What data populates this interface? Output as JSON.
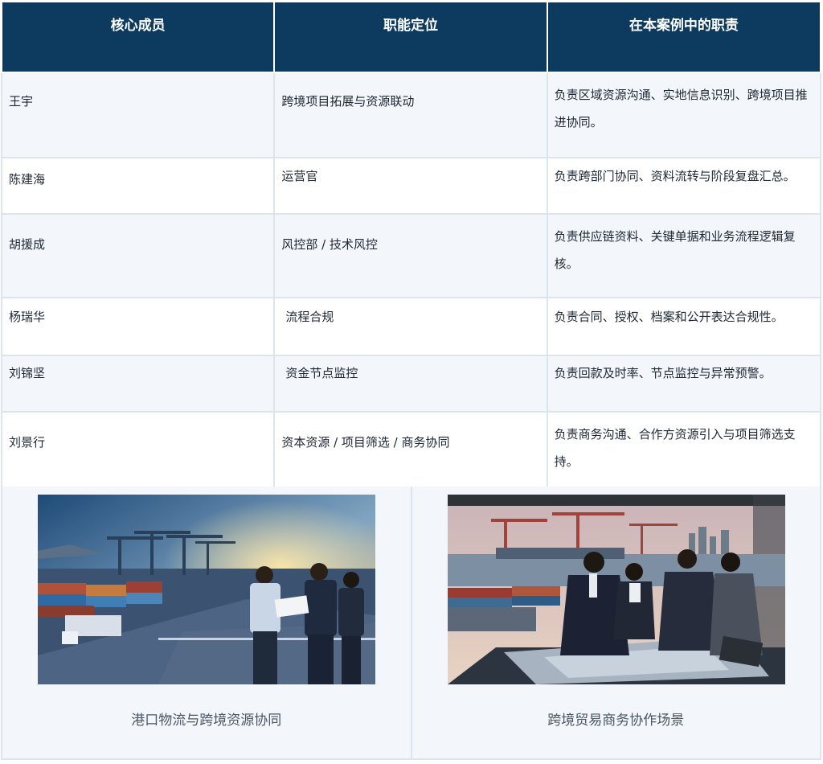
{
  "table": {
    "headers": [
      "核心成员",
      "职能定位",
      "在本案例中的职责"
    ],
    "rows": [
      {
        "name": "王宇",
        "role": "跨境项目拓展与资源联动",
        "duty": "负责区域资源沟通、实地信息识别、跨境项目推进协同。"
      },
      {
        "name": "陈建海",
        "role": "运营官",
        "duty": "负责跨部门协同、资料流转与阶段复盘汇总。"
      },
      {
        "name": "胡援成",
        "role": "风控部 / 技术风控",
        "duty": "负责供应链资料、关键单据和业务流程逻辑复核。"
      },
      {
        "name": "杨瑞华",
        "role": "流程合规",
        "duty": "负责合同、授权、档案和公开表达合规性。"
      },
      {
        "name": "刘锦坚",
        "role": "资金节点监控",
        "duty": "负责回款及时率、节点监控与异常预警。"
      },
      {
        "name": "刘景行",
        "role": "资本资源 / 项目筛选 / 商务协同",
        "duty": "负责商务沟通、合作方资源引入与项目筛选支持。"
      }
    ]
  },
  "gallery": [
    {
      "caption": "港口物流与跨境资源协同",
      "icon": "port-logistics-photo"
    },
    {
      "caption": "跨境贸易商务协作场景",
      "icon": "business-meeting-photo"
    }
  ]
}
